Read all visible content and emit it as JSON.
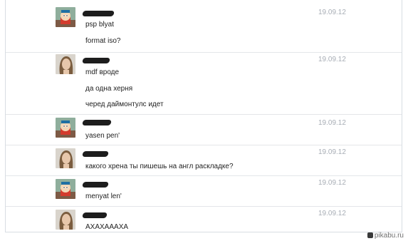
{
  "messages": [
    {
      "sender": "cartman",
      "date": "19.09.12",
      "lines": [
        "psp blyat",
        "format iso?"
      ]
    },
    {
      "sender": "girl",
      "date": "19.09.12",
      "lines": [
        "mdf вроде",
        "да одна херня",
        "черед даймонтулс идет"
      ]
    },
    {
      "sender": "cartman",
      "date": "19.09.12",
      "lines": [
        "yasen pen'"
      ]
    },
    {
      "sender": "girl",
      "date": "19.09.12",
      "lines": [
        "какого хрена ты пишешь на англ раскладке?"
      ]
    },
    {
      "sender": "cartman",
      "date": "19.09.12",
      "lines": [
        "menyat len'"
      ]
    },
    {
      "sender": "girl",
      "date": "19.09.12",
      "lines": [
        "АХАХАААХА"
      ]
    }
  ],
  "watermark": "pikabu.ru",
  "colors": {
    "date": "#a7adb5",
    "border": "#d8dde3",
    "text": "#222222"
  }
}
